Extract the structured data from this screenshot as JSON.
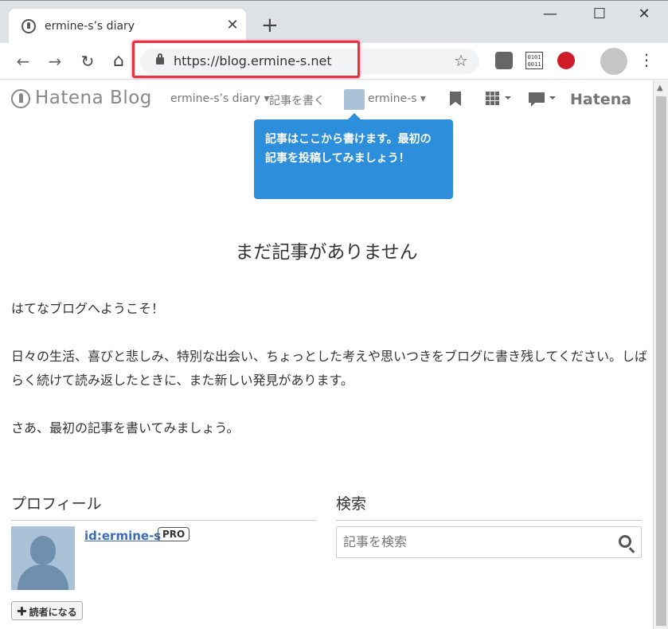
{
  "browser": {
    "tab_title": "ermine-s’s diary",
    "tab_close": "✕",
    "new_tab": "+",
    "url": "https://blog.ermine-s.net",
    "back": "←",
    "forward": "→",
    "reload": "↻",
    "home": "⌂",
    "bookmark_star": "☆",
    "menu": "⋮",
    "win_minimize": "—",
    "win_maximize": "☐",
    "win_close": "✕",
    "ext_binary": "0101 0011"
  },
  "hatena_bar": {
    "logo": "Hatena Blog",
    "blog_menu": "ermine-s’s diary ▾",
    "write": "記事を書く",
    "user": "ermine-s ▾",
    "brand": "Hatena"
  },
  "tooltip": {
    "text": "記事はここから書けます。最初の記事を投稿してみましょう！"
  },
  "main": {
    "title": "まだ記事がありません",
    "welcome": "はてなブログへようこそ！",
    "intro": "日々の生活、喜びと悲しみ、特別な出会い、ちょっとした考えや思いつきをブログに書き残してください。しばらく続けて読み返したときに、また新しい発見があります。",
    "cta": "さあ、最初の記事を書いてみましょう。"
  },
  "profile": {
    "heading": "プロフィール",
    "id": "id:ermine-s",
    "badge": "PRO",
    "subscribe": "読者になる"
  },
  "search": {
    "heading": "検索",
    "placeholder": "記事を検索"
  },
  "colors": {
    "tooltip_bg": "#2d8fdb",
    "highlight": "#e8323c",
    "link": "#3d6cb6"
  }
}
